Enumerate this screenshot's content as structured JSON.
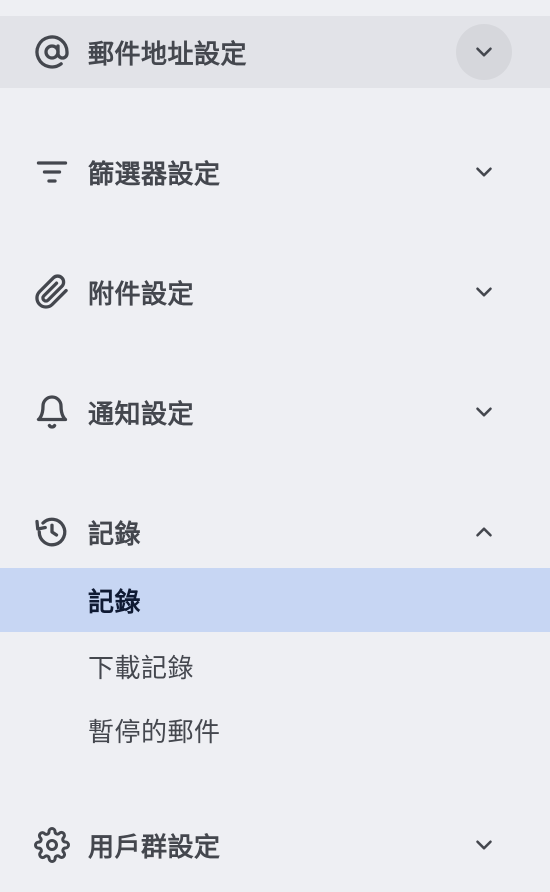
{
  "sections": [
    {
      "label": "郵件地址設定",
      "icon": "at-sign-icon",
      "expanded": false
    },
    {
      "label": "篩選器設定",
      "icon": "filter-icon",
      "expanded": false
    },
    {
      "label": "附件設定",
      "icon": "paperclip-icon",
      "expanded": false
    },
    {
      "label": "通知設定",
      "icon": "bell-icon",
      "expanded": false
    },
    {
      "label": "記錄",
      "icon": "history-icon",
      "expanded": true
    },
    {
      "label": "用戶群設定",
      "icon": "gear-icon",
      "expanded": false
    }
  ],
  "log_submenu": [
    {
      "label": "記錄",
      "selected": true
    },
    {
      "label": "下載記錄",
      "selected": false
    },
    {
      "label": "暫停的郵件",
      "selected": false
    }
  ],
  "colors": {
    "background": "#eeeff3",
    "active_section": "#e2e3e8",
    "selected_item": "#c7d6f3",
    "text": "#44474e"
  }
}
